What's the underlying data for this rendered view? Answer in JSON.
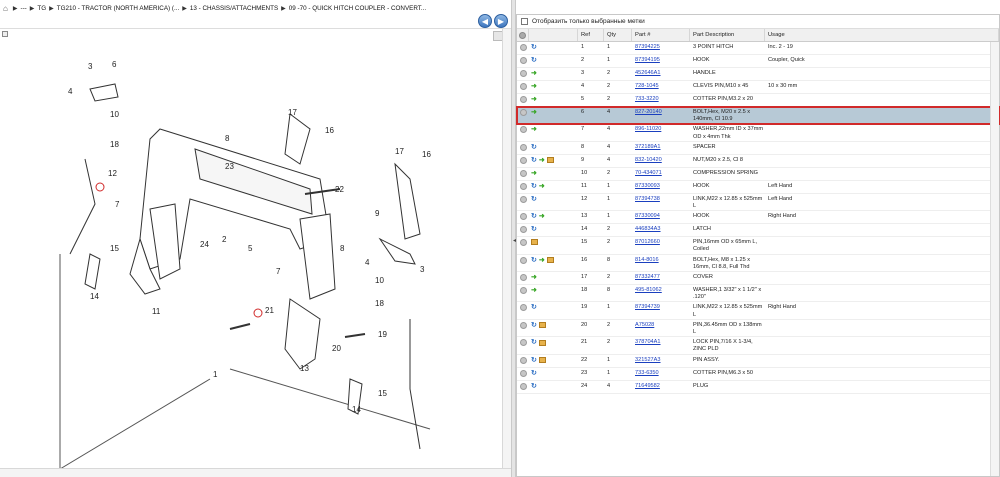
{
  "breadcrumb": {
    "home_icon": "home-icon",
    "items": [
      "---",
      "TG",
      "TG210 - TRACTOR (NORTH AMERICA) (...",
      "13 - CHASSIS/ATTACHMENTS",
      "09 -70 - QUICK HITCH COUPLER - CONVERT..."
    ]
  },
  "nav": {
    "back": "◀",
    "forward": "▶"
  },
  "filter": {
    "label": "Отобразить только выбранные метки"
  },
  "table": {
    "headers": [
      "",
      "",
      "Ref",
      "Qty",
      "Part #",
      "Part Description",
      "Usage"
    ],
    "rows": [
      {
        "icons": [
          "swap"
        ],
        "ref": "1",
        "qty": "1",
        "part": "87394225",
        "desc": "3 POINT HITCH",
        "usage": "Inc. 2 - 19"
      },
      {
        "icons": [
          "swap"
        ],
        "ref": "2",
        "qty": "1",
        "part": "87394195",
        "desc": "HOOK",
        "usage": "Coupler, Quick"
      },
      {
        "icons": [
          "arrow"
        ],
        "ref": "3",
        "qty": "2",
        "part": "452646A1",
        "desc": "HANDLE",
        "usage": ""
      },
      {
        "icons": [
          "arrow"
        ],
        "ref": "4",
        "qty": "2",
        "part": "728-1045",
        "desc": "CLEVIS PIN,M10 x 45",
        "usage": "10 x 30 mm"
      },
      {
        "icons": [
          "arrow"
        ],
        "ref": "5",
        "qty": "2",
        "part": "733-3220",
        "desc": "COTTER PIN,M3.2 x 20",
        "usage": ""
      },
      {
        "icons": [
          "arrow"
        ],
        "ref": "6",
        "qty": "4",
        "part": "827-20140",
        "desc": "BOLT,Hex, M20 x 2.5 x 140mm, Cl 10.9",
        "usage": "",
        "selected": true
      },
      {
        "icons": [
          "arrow"
        ],
        "ref": "7",
        "qty": "4",
        "part": "896-11020",
        "desc": "WASHER,22mm ID x 37mm OD x 4mm Thk",
        "usage": ""
      },
      {
        "icons": [
          "swap"
        ],
        "ref": "8",
        "qty": "4",
        "part": "372189A1",
        "desc": "SPACER",
        "usage": ""
      },
      {
        "icons": [
          "swap",
          "arrow",
          "box"
        ],
        "ref": "9",
        "qty": "4",
        "part": "832-10420",
        "desc": "NUT,M20 x 2.5, Cl 8",
        "usage": ""
      },
      {
        "icons": [
          "arrow"
        ],
        "ref": "10",
        "qty": "2",
        "part": "70-434071",
        "desc": "COMPRESSION SPRING",
        "usage": ""
      },
      {
        "icons": [
          "swap",
          "arrow"
        ],
        "ref": "11",
        "qty": "1",
        "part": "87330093",
        "desc": "HOOK",
        "usage": "Left Hand"
      },
      {
        "icons": [
          "swap"
        ],
        "ref": "12",
        "qty": "1",
        "part": "87394738",
        "desc": "LINK,M22 x 12.85 x 525mm L",
        "usage": "Left Hand"
      },
      {
        "icons": [
          "swap",
          "arrow"
        ],
        "ref": "13",
        "qty": "1",
        "part": "87330094",
        "desc": "HOOK",
        "usage": "Right Hand"
      },
      {
        "icons": [
          "swap"
        ],
        "ref": "14",
        "qty": "2",
        "part": "446834A3",
        "desc": "LATCH",
        "usage": ""
      },
      {
        "icons": [
          "box"
        ],
        "ref": "15",
        "qty": "2",
        "part": "87012660",
        "desc": "PIN,16mm OD x 65mm L, Coiled",
        "usage": ""
      },
      {
        "icons": [
          "swap",
          "arrow",
          "box"
        ],
        "ref": "16",
        "qty": "8",
        "part": "814-8016",
        "desc": "BOLT,Hex, M8 x 1.25 x 16mm, Cl 8.8, Full Thd",
        "usage": ""
      },
      {
        "icons": [
          "arrow"
        ],
        "ref": "17",
        "qty": "2",
        "part": "87332477",
        "desc": "COVER",
        "usage": ""
      },
      {
        "icons": [
          "arrow"
        ],
        "ref": "18",
        "qty": "8",
        "part": "495-81062",
        "desc": "WASHER,1 3/32\" x 1 1/2\" x .120\"",
        "usage": ""
      },
      {
        "icons": [
          "swap"
        ],
        "ref": "19",
        "qty": "1",
        "part": "87394739",
        "desc": "LINK,M22 x 12.85 x 525mm L",
        "usage": "Right Hand"
      },
      {
        "icons": [
          "swap",
          "box"
        ],
        "ref": "20",
        "qty": "2",
        "part": "A75028",
        "desc": "PIN,36.45mm OD x 138mm L",
        "usage": ""
      },
      {
        "icons": [
          "swap",
          "box"
        ],
        "ref": "21",
        "qty": "2",
        "part": "378704A1",
        "desc": "LOCK PIN,7/16 X 1-3/4, ZINC PLD",
        "usage": ""
      },
      {
        "icons": [
          "swap",
          "box"
        ],
        "ref": "22",
        "qty": "1",
        "part": "321527A3",
        "desc": "PIN ASSY.",
        "usage": ""
      },
      {
        "icons": [
          "swap"
        ],
        "ref": "23",
        "qty": "1",
        "part": "733-6350",
        "desc": "COTTER PIN,M6.3 x 50",
        "usage": ""
      },
      {
        "icons": [
          "swap"
        ],
        "ref": "24",
        "qty": "4",
        "part": "71649582",
        "desc": "PLUG",
        "usage": ""
      }
    ]
  },
  "drawing": {
    "callouts": [
      "1",
      "2",
      "3",
      "3",
      "4",
      "4",
      "5",
      "6",
      "7",
      "7",
      "8",
      "8",
      "9",
      "10",
      "10",
      "11",
      "12",
      "13",
      "14",
      "14",
      "15",
      "15",
      "16",
      "16",
      "17",
      "17",
      "18",
      "18",
      "19",
      "20",
      "21",
      "22",
      "23",
      "24"
    ]
  }
}
